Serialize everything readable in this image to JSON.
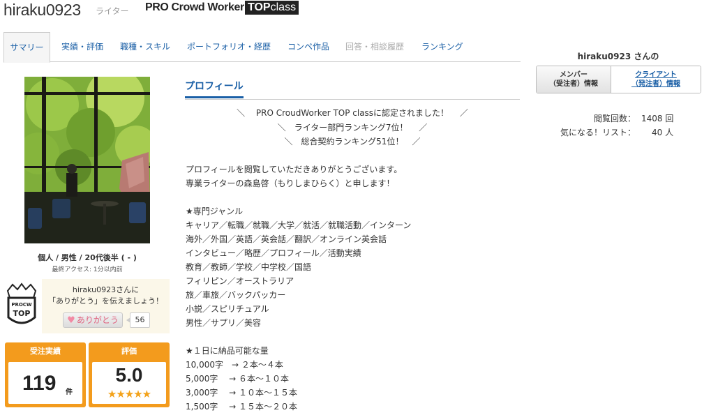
{
  "header": {
    "username": "hiraku0923",
    "role": "ライター",
    "pro_title": "PRO Crowd Worker",
    "badge_top": "TOP",
    "badge_class": "class"
  },
  "tabs": [
    {
      "label": "サマリー",
      "state": "active"
    },
    {
      "label": "実績・評価",
      "state": "normal"
    },
    {
      "label": "職種・スキル",
      "state": "normal"
    },
    {
      "label": "ポートフォリオ・経歴",
      "state": "normal"
    },
    {
      "label": "コンペ作品",
      "state": "normal"
    },
    {
      "label": "回答・相談履歴",
      "state": "disabled"
    },
    {
      "label": "ランキング",
      "state": "normal"
    }
  ],
  "left": {
    "user_meta": "個人 / 男性 / 20代後半 ( - )",
    "last_access": "最終アクセス: 1分以内前",
    "badge_logo_text": [
      "PROCW",
      "TOP"
    ],
    "thanks": {
      "line1": "hiraku0923さんに",
      "line2": "「ありがとう」を伝えましょう！",
      "button_label": "ありがとう",
      "count": "56"
    },
    "orders": {
      "label": "受注実績",
      "value": "119",
      "unit": "件"
    },
    "rating": {
      "label": "評価",
      "value": "5.0",
      "stars": "★★★★★"
    }
  },
  "profile": {
    "title": "プロフィール",
    "centered": [
      "＼　 PRO CroudWorker TOP classに認定されました！　 ／",
      "＼　ライター部門ランキング7位！　 ／",
      "＼　総合契約ランキング51位！　／"
    ],
    "body": [
      "プロフィールを閲覧していただきありがとうございます。",
      "専業ライターの森島啓（もりしまひらく）と申します！",
      "",
      "★専門ジャンル",
      "キャリア／転職／就職／大学／就活／就職活動／インターン",
      "海外／外国／英語／英会話／翻訳／オンライン英会話",
      "インタビュー／略歴／プロフィール／活動実績",
      "教育／教師／学校／中学校／国語",
      "フィリピン／オーストラリア",
      "旅／車旅／バックパッカー",
      "小説／スピリチュアル",
      "男性／サプリ／美容",
      "",
      "★１日に納品可能な量",
      "10,000字　→ ２本～４本",
      "5,000字　 → ６本～１０本",
      "3,000字　 → １０本～１５本",
      "1,500字　 → １５本～２０本"
    ]
  },
  "right": {
    "name_line": "hiraku0923 さんの",
    "member_tab": [
      "メンバー",
      "（受注者）情報"
    ],
    "client_tab": [
      "クライアント",
      "（発注者）情報"
    ],
    "views_label": "閲覧回数：",
    "views_value": "1408 回",
    "watch_label": "気になる！リスト：",
    "watch_value": "40 人"
  },
  "colors": {
    "link": "#1a5fa6",
    "orange": "#f39b1d",
    "thanks_bg": "#fbf7e9"
  }
}
